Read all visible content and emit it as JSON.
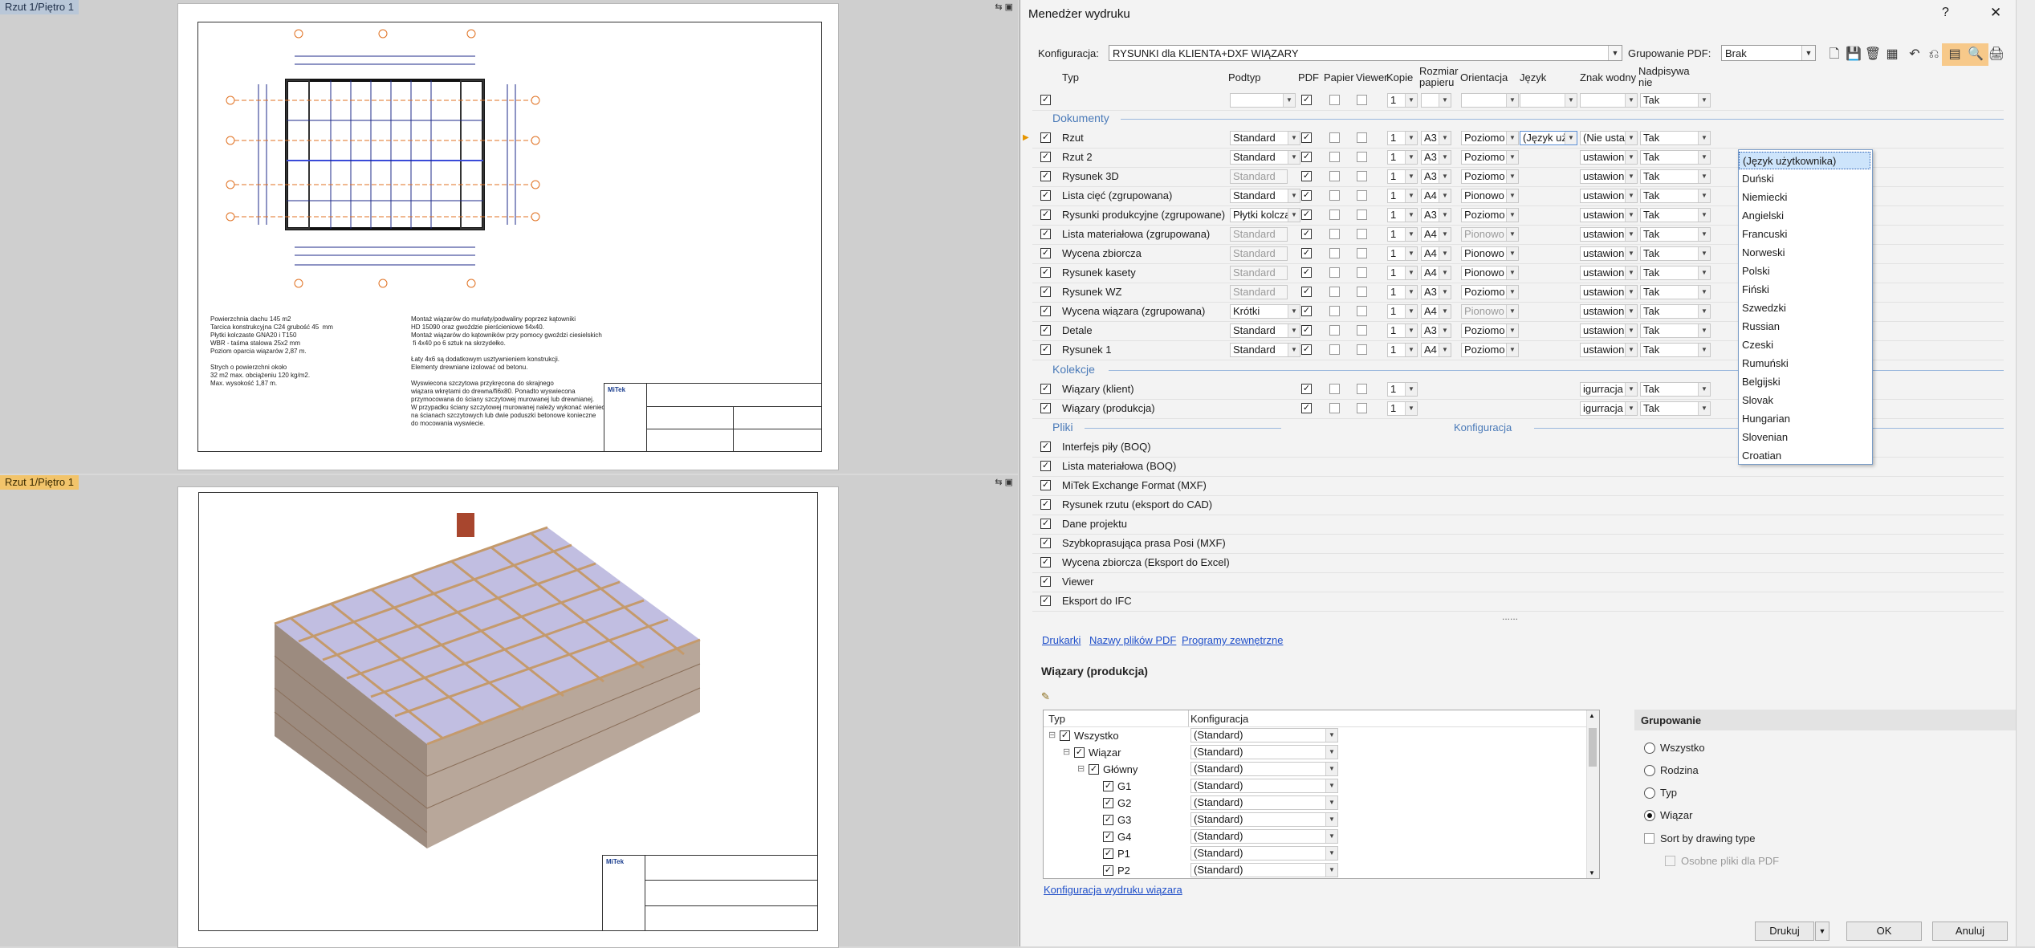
{
  "viewports": {
    "top_title": "Rzut 1/Piętro 1",
    "bottom_title": "Rzut 1/Piętro 1",
    "top_ctrl": "⇆ ▣",
    "bottom_ctrl": "⇆ ▣",
    "notes_left": "Powierzchnia dachu 145 m2\nTarcica konstrukcyjna C24 grubość 45  mm\nPłytki kolczaste GNA20 i T150\nWBR - taśma stalowa 25x2 mm\nPoziom oparcia wiązarów 2,87 m.\n\nStrych o powierzchni około\n32 m2 max. obciążeniu 120 kg/m2.\nMax. wysokość 1,87 m.",
    "notes_right": "Montaż wiązarów do murłaty/podwaliny poprzez kątowniki\nHD 15090 oraz gwoździe pierścieniowe fi4x40.\nMontaż wiązarów do kątowników przy pomocy gwoździ ciesielskich\n fi 4x40 po 6 sztuk na skrzydełko.\n\nŁaty 4x6 są dodatkowym usztywnieniem konstrukcji.\nElementy drewniane izolować od betonu.\n\nWyswiecona szczytowa przykręcona do skrajnego\nwiązara wkrętami do drewna/fi6x80. Ponadto wyswiecona\nprzymocowana do ściany szczytowej murowanej lub drewnianej.\nW przypadku ściany szczytowej murowanej należy wykonać wieniec\nna ścianach szczytowych lub dwie poduszki betonowe konieczne\ndo mocowania wyswiecie.",
    "logo": "MiTek"
  },
  "dialog": {
    "title": "Menedżer wydruku",
    "help": "?",
    "close": "✕",
    "config_label": "Konfiguracja:",
    "config_value": "RYSUNKI dla KLIENTA+DXF WIĄZARY",
    "pdf_group_label": "Grupowanie PDF:",
    "pdf_group_value": "Brak",
    "toolbar": [
      "🗋",
      "💾",
      "🗑",
      "▦",
      "↶",
      "⎌",
      "▤",
      "🔍",
      "🖨"
    ],
    "columns": [
      "Typ",
      "Podtyp",
      "PDF",
      "Papier",
      "Viewer",
      "Kopie",
      "Rozmiar papieru",
      "Orientacja",
      "Język",
      "Znak wodny",
      "Nadpisywanie"
    ],
    "filter_row": {
      "copies": "1",
      "override": "Tak"
    },
    "section_documents": "Dokumenty",
    "section_collections": "Kolekcje",
    "section_files": "Pliki",
    "files_config": "Konfiguracja",
    "documents": [
      {
        "type": "Rzut",
        "sub": "Standard",
        "pdf": true,
        "paper": false,
        "viewer": false,
        "copies": "1",
        "size": "A3",
        "orient": "Poziomo",
        "lang": "(Język użytko",
        "wm": "(Nie ustawion",
        "ov": "Tak",
        "sub_dis": false,
        "orient_dis": false
      },
      {
        "type": "Rzut 2",
        "sub": "Standard",
        "pdf": true,
        "paper": false,
        "viewer": false,
        "copies": "1",
        "size": "A3",
        "orient": "Poziomo",
        "lang": "",
        "wm": "ustawion",
        "ov": "Tak",
        "sub_dis": false,
        "orient_dis": false
      },
      {
        "type": "Rysunek 3D",
        "sub": "Standard",
        "pdf": true,
        "paper": false,
        "viewer": false,
        "copies": "1",
        "size": "A3",
        "orient": "Poziomo",
        "lang": "",
        "wm": "ustawion",
        "ov": "Tak",
        "sub_dis": true,
        "orient_dis": false
      },
      {
        "type": "Lista cięć (zgrupowana)",
        "sub": "Standard",
        "pdf": true,
        "paper": false,
        "viewer": false,
        "copies": "1",
        "size": "A4",
        "orient": "Pionowo",
        "lang": "",
        "wm": "ustawion",
        "ov": "Tak",
        "sub_dis": false,
        "orient_dis": false
      },
      {
        "type": "Rysunki produkcyjne (zgrupowane)",
        "sub": "Płytki kolczast",
        "pdf": true,
        "paper": false,
        "viewer": false,
        "copies": "1",
        "size": "A3",
        "orient": "Poziomo",
        "lang": "",
        "wm": "ustawion",
        "ov": "Tak",
        "sub_dis": false,
        "orient_dis": false
      },
      {
        "type": "Lista materiałowa (zgrupowana)",
        "sub": "Standard",
        "pdf": true,
        "paper": false,
        "viewer": false,
        "copies": "1",
        "size": "A4",
        "orient": "Pionowo",
        "lang": "",
        "wm": "ustawion",
        "ov": "Tak",
        "sub_dis": true,
        "orient_dis": true
      },
      {
        "type": "Wycena zbiorcza",
        "sub": "Standard",
        "pdf": true,
        "paper": false,
        "viewer": false,
        "copies": "1",
        "size": "A4",
        "orient": "Pionowo",
        "lang": "",
        "wm": "ustawion",
        "ov": "Tak",
        "sub_dis": true,
        "orient_dis": false
      },
      {
        "type": "Rysunek kasety",
        "sub": "Standard",
        "pdf": true,
        "paper": false,
        "viewer": false,
        "copies": "1",
        "size": "A4",
        "orient": "Pionowo",
        "lang": "",
        "wm": "ustawion",
        "ov": "Tak",
        "sub_dis": true,
        "orient_dis": false
      },
      {
        "type": "Rysunek WZ",
        "sub": "Standard",
        "pdf": true,
        "paper": false,
        "viewer": false,
        "copies": "1",
        "size": "A3",
        "orient": "Poziomo",
        "lang": "",
        "wm": "ustawion",
        "ov": "Tak",
        "sub_dis": true,
        "orient_dis": false
      },
      {
        "type": "Wycena wiązara (zgrupowana)",
        "sub": "Krótki",
        "pdf": true,
        "paper": false,
        "viewer": false,
        "copies": "1",
        "size": "A4",
        "orient": "Pionowo",
        "lang": "",
        "wm": "ustawion",
        "ov": "Tak",
        "sub_dis": false,
        "orient_dis": true
      },
      {
        "type": "Detale",
        "sub": "Standard",
        "pdf": true,
        "paper": false,
        "viewer": false,
        "copies": "1",
        "size": "A3",
        "orient": "Poziomo",
        "lang": "",
        "wm": "ustawion",
        "ov": "Tak",
        "sub_dis": false,
        "orient_dis": false
      },
      {
        "type": "Rysunek 1",
        "sub": "Standard",
        "pdf": true,
        "paper": false,
        "viewer": false,
        "copies": "1",
        "size": "A4",
        "orient": "Poziomo",
        "lang": "",
        "wm": "ustawion",
        "ov": "Tak",
        "sub_dis": false,
        "orient_dis": false
      }
    ],
    "collections": [
      {
        "type": "Wiązary (klient)",
        "pdf": true,
        "paper": false,
        "viewer": false,
        "copies": "1",
        "wm": "igurracja",
        "ov": "Tak"
      },
      {
        "type": "Wiązary (produkcja)",
        "pdf": true,
        "paper": false,
        "viewer": false,
        "copies": "1",
        "wm": "igurracja",
        "ov": "Tak"
      }
    ],
    "files": [
      "Interfejs piły (BOQ)",
      "Lista materiałowa (BOQ)",
      "MiTek Exchange Format (MXF)",
      "Rysunek rzutu (eksport do CAD)",
      "Dane projektu",
      "Szybkoprasująca prasa Posi (MXF)",
      "Wycena zbiorcza (Eksport do Excel)",
      "Viewer",
      "Eksport do IFC"
    ],
    "language_options": [
      "(Język użytkownika)",
      "Duński",
      "Niemiecki",
      "Angielski",
      "Francuski",
      "Norweski",
      "Polski",
      "Fiński",
      "Szwedzki",
      "Russian",
      "Czeski",
      "Rumuński",
      "Belgijski",
      "Slovak",
      "Hungarian",
      "Slovenian",
      "Croatian"
    ],
    "splitter": "......",
    "links": {
      "printers": "Drukarki",
      "pdf_names": "Nazwy plików PDF",
      "external": "Programy zewnętrzne"
    },
    "panel_title": "Wiązary (produkcja)",
    "tree_headers": [
      "Typ",
      "Konfiguracja"
    ],
    "tree": [
      {
        "label": "Wszystko",
        "cfg": "(Standard)",
        "indent": 0,
        "exp": "⊟"
      },
      {
        "label": "Wiązar",
        "cfg": "(Standard)",
        "indent": 1,
        "exp": "⊟"
      },
      {
        "label": "Główny",
        "cfg": "(Standard)",
        "indent": 2,
        "exp": "⊟"
      },
      {
        "label": "G1",
        "cfg": "(Standard)",
        "indent": 3,
        "exp": ""
      },
      {
        "label": "G2",
        "cfg": "(Standard)",
        "indent": 3,
        "exp": ""
      },
      {
        "label": "G3",
        "cfg": "(Standard)",
        "indent": 3,
        "exp": ""
      },
      {
        "label": "G4",
        "cfg": "(Standard)",
        "indent": 3,
        "exp": ""
      },
      {
        "label": "P1",
        "cfg": "(Standard)",
        "indent": 3,
        "exp": ""
      },
      {
        "label": "P2",
        "cfg": "(Standard)",
        "indent": 3,
        "exp": ""
      }
    ],
    "truss_config_link": "Konfiguracja wydruku wiązara",
    "grouping_title": "Grupowanie",
    "grouping_options": [
      "Wszystko",
      "Rodzina",
      "Typ",
      "Wiązar"
    ],
    "grouping_selected": "Wiązar",
    "sort_by_drawing_type": "Sort by drawing type",
    "separate_pdf": "Osobne pliki dla PDF",
    "buttons": {
      "print": "Drukuj",
      "ok": "OK",
      "cancel": "Anuluj"
    },
    "accent": "#4a7ab8"
  }
}
